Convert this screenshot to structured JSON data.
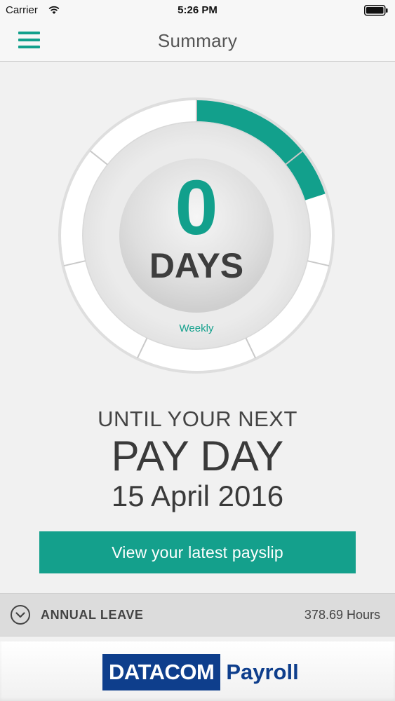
{
  "status_bar": {
    "carrier": "Carrier",
    "time": "5:26 PM",
    "icons": [
      "wifi-icon",
      "battery-icon"
    ]
  },
  "nav": {
    "title": "Summary",
    "menu_icon": "hamburger-menu-icon"
  },
  "countdown": {
    "value": "0",
    "unit": "DAYS",
    "frequency": "Weekly",
    "progress_fraction": 0.2,
    "segments": 7
  },
  "payday": {
    "until_text": "UNTIL YOUR NEXT",
    "title": "PAY DAY",
    "date": "15 April 2016"
  },
  "payslip_button": {
    "label": "View your latest payslip"
  },
  "annual_leave": {
    "label": "ANNUAL LEAVE",
    "value": "378.69 Hours",
    "icon": "chevron-down-circle-icon"
  },
  "footer": {
    "logo_brand": "DATACOM",
    "logo_product": "Payroll"
  },
  "colors": {
    "accent": "#12a08c",
    "brand_blue": "#0e3e8c",
    "background": "#f1f1f1"
  }
}
